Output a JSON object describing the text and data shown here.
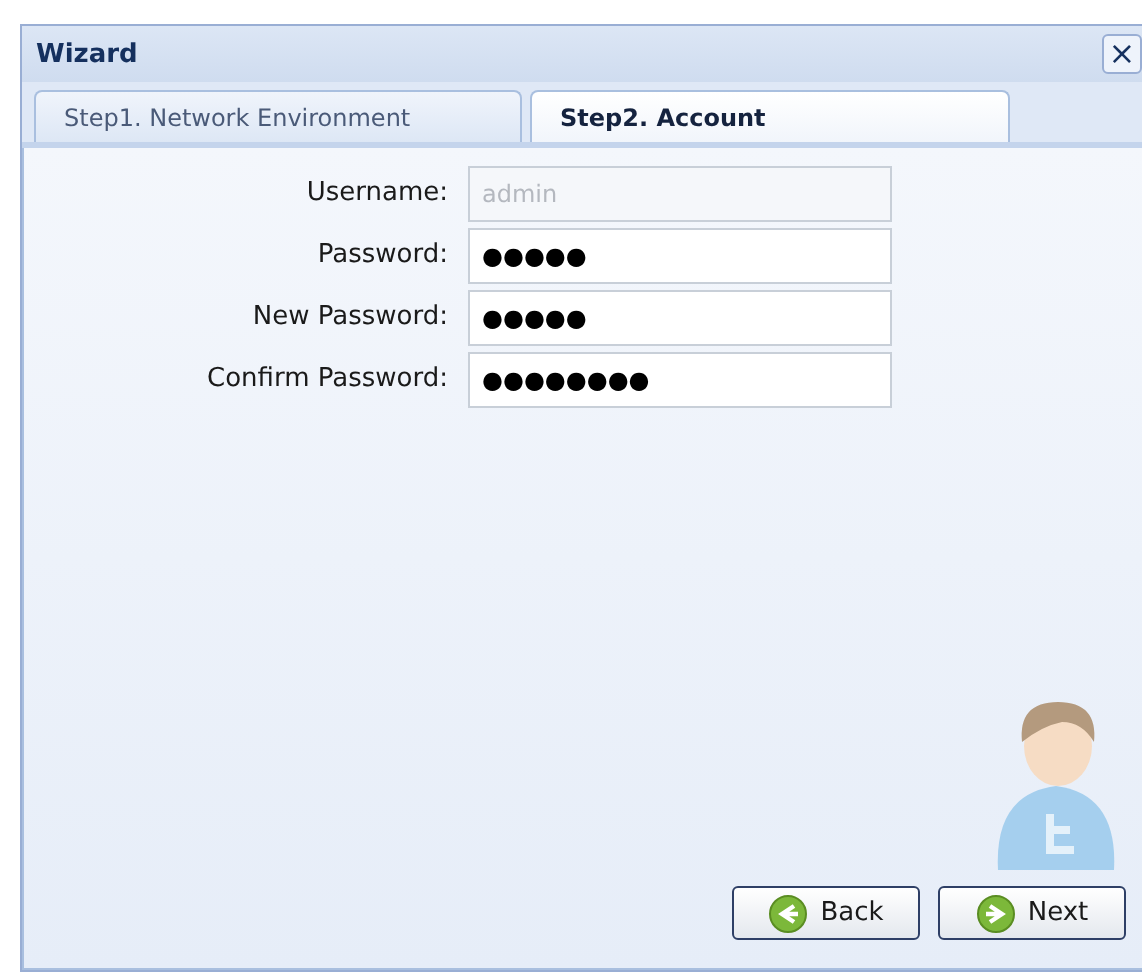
{
  "window": {
    "title": "Wizard",
    "close": "×"
  },
  "tabs": [
    {
      "label": "Step1. Network Environment",
      "selected": false
    },
    {
      "label": "Step2. Account",
      "selected": true
    }
  ],
  "fields": [
    {
      "label": "Username:",
      "value": "admin",
      "disabled": true
    },
    {
      "label": "Password:",
      "value": "●●●●●",
      "disabled": false
    },
    {
      "label": "New Password:",
      "value": "●●●●●",
      "disabled": false
    },
    {
      "label": "Confirm Password:",
      "value": "●●●●●●●●",
      "disabled": false
    }
  ],
  "buttons": [
    {
      "label": "Back",
      "kind": "back"
    },
    {
      "label": "Next",
      "kind": "next"
    }
  ]
}
